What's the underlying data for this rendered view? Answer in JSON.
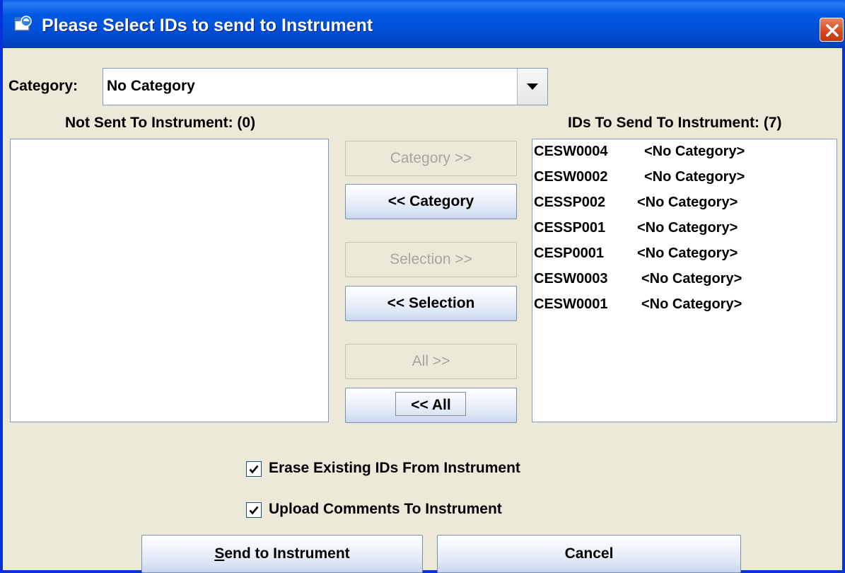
{
  "window": {
    "title": "Please Select IDs to send to Instrument"
  },
  "category": {
    "label": "Category:",
    "selected": "No Category"
  },
  "left_list": {
    "title": "Not Sent To Instrument: (0)",
    "items": []
  },
  "right_list": {
    "title": "IDs To Send To Instrument: (7)",
    "items": [
      {
        "id": "CESW0004",
        "category": "<No Category>"
      },
      {
        "id": "CESW0002",
        "category": "<No Category>"
      },
      {
        "id": "CESSP002",
        "category": "<No Category>"
      },
      {
        "id": "CESSP001",
        "category": "<No Category>"
      },
      {
        "id": "CESP0001",
        "category": "<No Category>"
      },
      {
        "id": "CESW0003",
        "category": "<No Category>"
      },
      {
        "id": "CESW0001",
        "category": "<No Category>"
      }
    ]
  },
  "transfer_buttons": {
    "category_right": "Category >>",
    "category_left": "<< Category",
    "selection_right": "Selection >>",
    "selection_left": "<< Selection",
    "all_right": "All >>",
    "all_left": "<< All"
  },
  "options": {
    "erase_existing": {
      "label": "Erase Existing IDs From Instrument",
      "checked": true
    },
    "upload_comments": {
      "label": "Upload Comments To Instrument",
      "checked": true
    }
  },
  "footer": {
    "send_label_mnemonic": "S",
    "send_label_rest": "end to Instrument",
    "cancel_label": "Cancel"
  },
  "colors": {
    "titlebar": "#0054e3",
    "dialog_bg": "#ece9d8",
    "close_button": "#d3471c"
  }
}
